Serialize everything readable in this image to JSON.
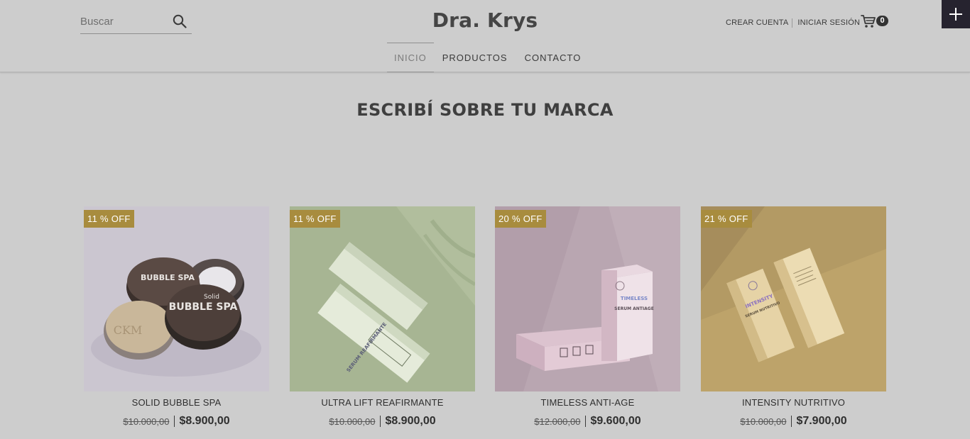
{
  "header": {
    "search_placeholder": "Buscar",
    "brand": "Dra. Krys",
    "create_account": "CREAR CUENTA",
    "login": "INICIAR SESIÓN",
    "cart_count": "0"
  },
  "nav": {
    "items": [
      "INICIO",
      "PRODUCTOS",
      "CONTACTO"
    ],
    "active": "INICIO"
  },
  "headline": "ESCRIBÍ SOBRE TU MARCA",
  "products": [
    {
      "name": "SOLID BUBBLE SPA",
      "discount": "11 % OFF",
      "old_price": "$10.000,00",
      "price": "$8.900,00"
    },
    {
      "name": "ULTRA LIFT REAFIRMANTE",
      "discount": "11 % OFF",
      "old_price": "$10.000,00",
      "price": "$8.900,00"
    },
    {
      "name": "TIMELESS ANTI-AGE",
      "discount": "20 % OFF",
      "old_price": "$12.000,00",
      "price": "$9.600,00"
    },
    {
      "name": "INTENSITY NUTRITIVO",
      "discount": "21 % OFF",
      "old_price": "$10.000,00",
      "price": "$7.900,00"
    }
  ],
  "product_labels": {
    "jar_brand": "Solid",
    "jar_text": "BUBBLE SPA",
    "jar_logo": "CKM",
    "serum_2": "SERUM REAFIRMANTE",
    "serum_3_top": "TIMELESS",
    "serum_3_bottom": "SERUM ANTIAGE",
    "serum_4_top": "INTENSITY",
    "serum_4_bottom": "SERUM NUTRITIVO"
  },
  "colors": {
    "page_bg": "#cdcdcd",
    "badge": "#a88c3e",
    "cart_badge": "#333333",
    "plus_button": "#26232f"
  }
}
